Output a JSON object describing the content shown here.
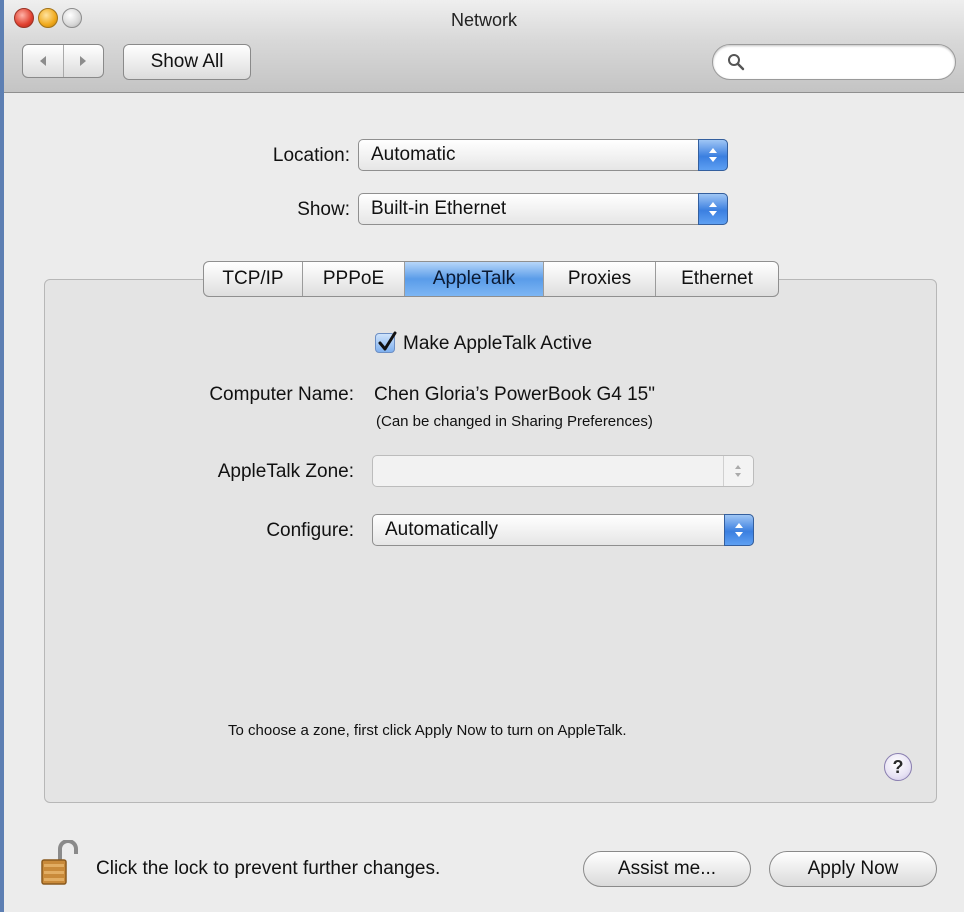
{
  "window": {
    "title": "Network"
  },
  "toolbar": {
    "back_icon": "back-arrow-icon",
    "forward_icon": "forward-arrow-icon",
    "show_all_label": "Show All",
    "search_placeholder": ""
  },
  "location": {
    "label": "Location:",
    "value": "Automatic"
  },
  "show": {
    "label": "Show:",
    "value": "Built-in Ethernet"
  },
  "tabs": [
    {
      "label": "TCP/IP",
      "active": false
    },
    {
      "label": "PPPoE",
      "active": false
    },
    {
      "label": "AppleTalk",
      "active": true
    },
    {
      "label": "Proxies",
      "active": false
    },
    {
      "label": "Ethernet",
      "active": false
    }
  ],
  "appletalk": {
    "active_checkbox": {
      "label": "Make AppleTalk Active",
      "checked": true
    },
    "computer_name": {
      "label": "Computer Name:",
      "value": "Chen Gloria’s PowerBook G4 15\"",
      "hint": "(Can be changed in Sharing Preferences)"
    },
    "zone": {
      "label": "AppleTalk Zone:",
      "value": "",
      "enabled": false
    },
    "configure": {
      "label": "Configure:",
      "value": "Automatically"
    },
    "info": "To choose a zone, first click Apply Now to turn on AppleTalk.",
    "help_label": "?"
  },
  "footer": {
    "lock_icon": "unlocked-padlock-icon",
    "lock_text": "Click the lock to prevent further changes.",
    "assist_label": "Assist me...",
    "apply_label": "Apply Now"
  },
  "colors": {
    "accent": "#3b7fe0",
    "window_border": "#5d7fb3"
  }
}
